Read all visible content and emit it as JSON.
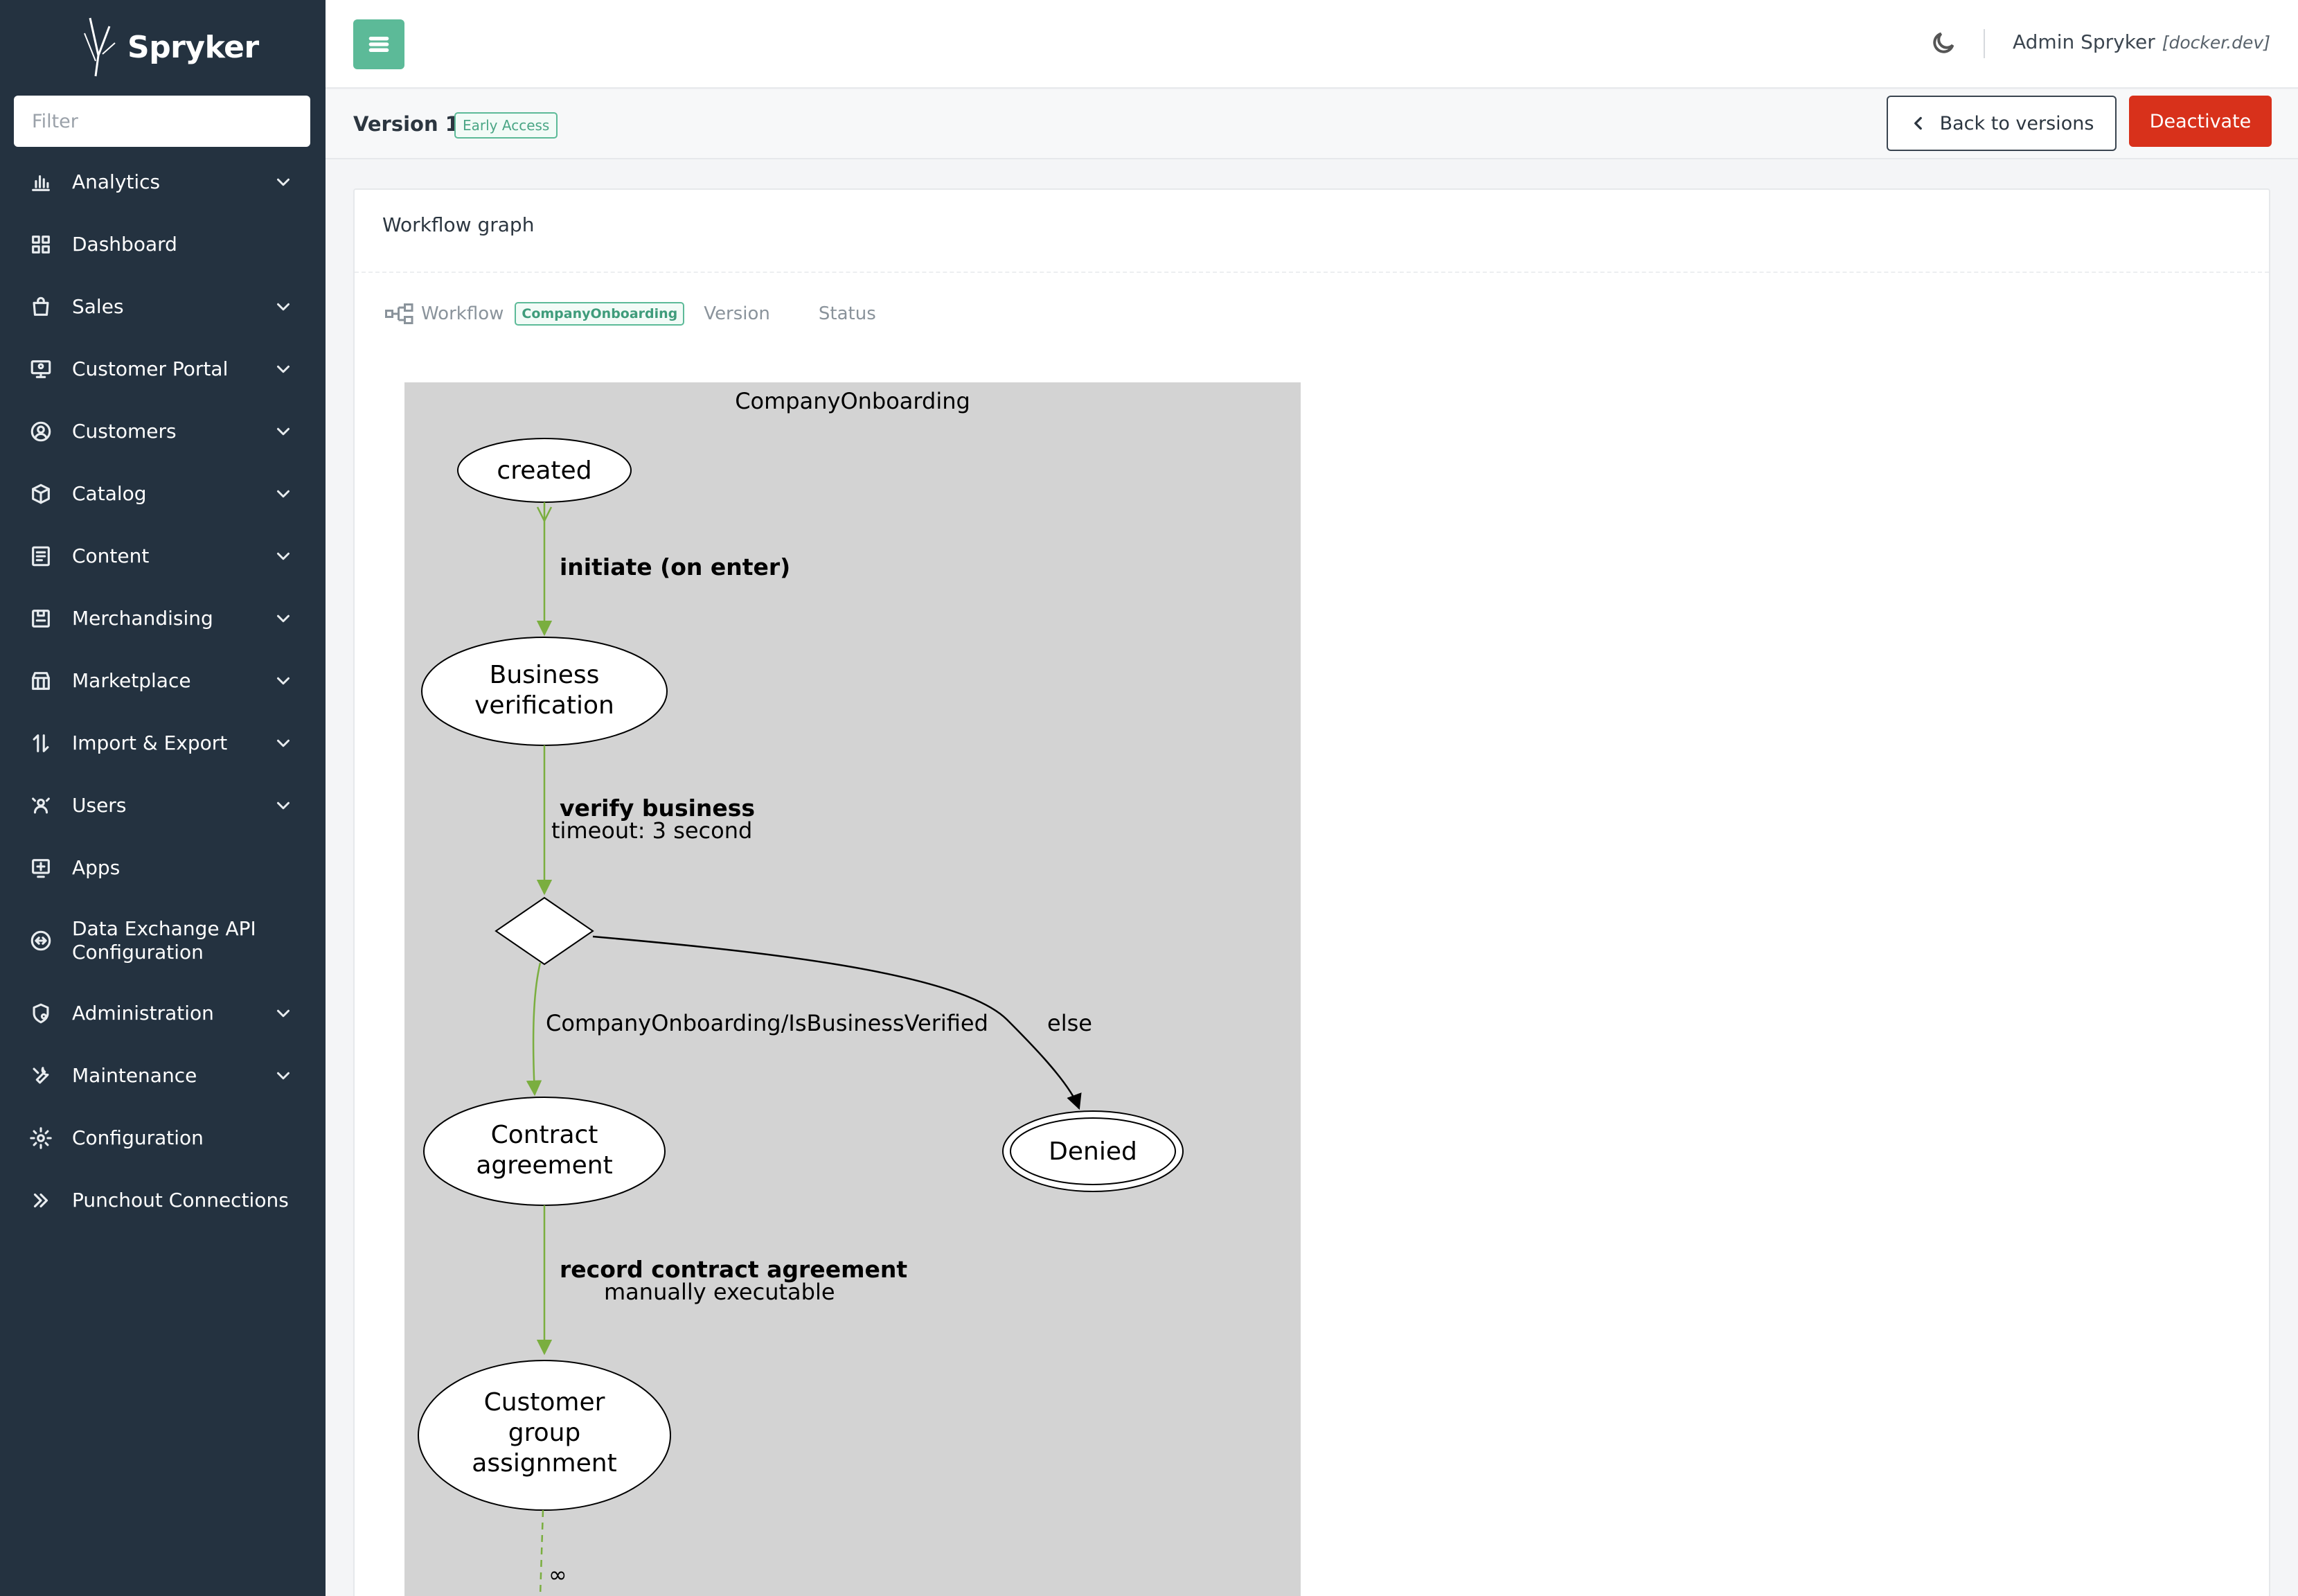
{
  "brand": {
    "name": "Spryker"
  },
  "filter": {
    "placeholder": "Filter"
  },
  "sidebar": {
    "items": [
      {
        "label": "Analytics",
        "icon": "bar-chart-icon",
        "chevron": true
      },
      {
        "label": "Dashboard",
        "icon": "grid-icon",
        "chevron": false
      },
      {
        "label": "Sales",
        "icon": "shopping-bag-icon",
        "chevron": true
      },
      {
        "label": "Customer Portal",
        "icon": "monitor-user-icon",
        "chevron": true
      },
      {
        "label": "Customers",
        "icon": "user-circle-icon",
        "chevron": true
      },
      {
        "label": "Catalog",
        "icon": "box-icon",
        "chevron": true
      },
      {
        "label": "Content",
        "icon": "document-icon",
        "chevron": true
      },
      {
        "label": "Merchandising",
        "icon": "merch-icon",
        "chevron": true
      },
      {
        "label": "Marketplace",
        "icon": "store-icon",
        "chevron": true
      },
      {
        "label": "Import & Export",
        "icon": "arrows-updown-icon",
        "chevron": true
      },
      {
        "label": "Users",
        "icon": "users-icon",
        "chevron": true
      },
      {
        "label": "Apps",
        "icon": "plus-square-icon",
        "chevron": false
      },
      {
        "label": "Data Exchange API\nConfiguration",
        "icon": "exchange-icon",
        "chevron": false
      },
      {
        "label": "Administration",
        "icon": "shield-gear-icon",
        "chevron": true
      },
      {
        "label": "Maintenance",
        "icon": "wrench-icon",
        "chevron": true
      },
      {
        "label": "Configuration",
        "icon": "gear-icon",
        "chevron": false
      },
      {
        "label": "Punchout Connections",
        "icon": "double-chevron-icon",
        "chevron": false
      }
    ]
  },
  "topbar": {
    "user_name": "Admin Spryker",
    "environment": "[docker.dev]"
  },
  "titlebar": {
    "version_title": "Version 1",
    "badge": "Early Access",
    "back_label": "Back to versions",
    "deactivate_label": "Deactivate"
  },
  "card": {
    "title": "Workflow graph",
    "meta": {
      "workflow_label": "Workflow",
      "workflow_badge": "CompanyOnboarding",
      "version_label": "Version",
      "status_label": "Status"
    }
  },
  "graph": {
    "title": "CompanyOnboarding",
    "states": {
      "created": "created",
      "business_verification_l1": "Business",
      "business_verification_l2": "verification",
      "contract_l1": "Contract",
      "contract_l2": "agreement",
      "denied": "Denied",
      "cga_l1": "Customer",
      "cga_l2": "group",
      "cga_l3": "assignment"
    },
    "transitions": {
      "initiate": "initiate (on enter)",
      "verify": "verify business",
      "verify_timeout": "timeout:  3 second",
      "condition": "CompanyOnboarding/IsBusinessVerified",
      "else": "else",
      "record": "record contract agreement",
      "record_sub": "manually executable",
      "loop": "∞"
    }
  }
}
